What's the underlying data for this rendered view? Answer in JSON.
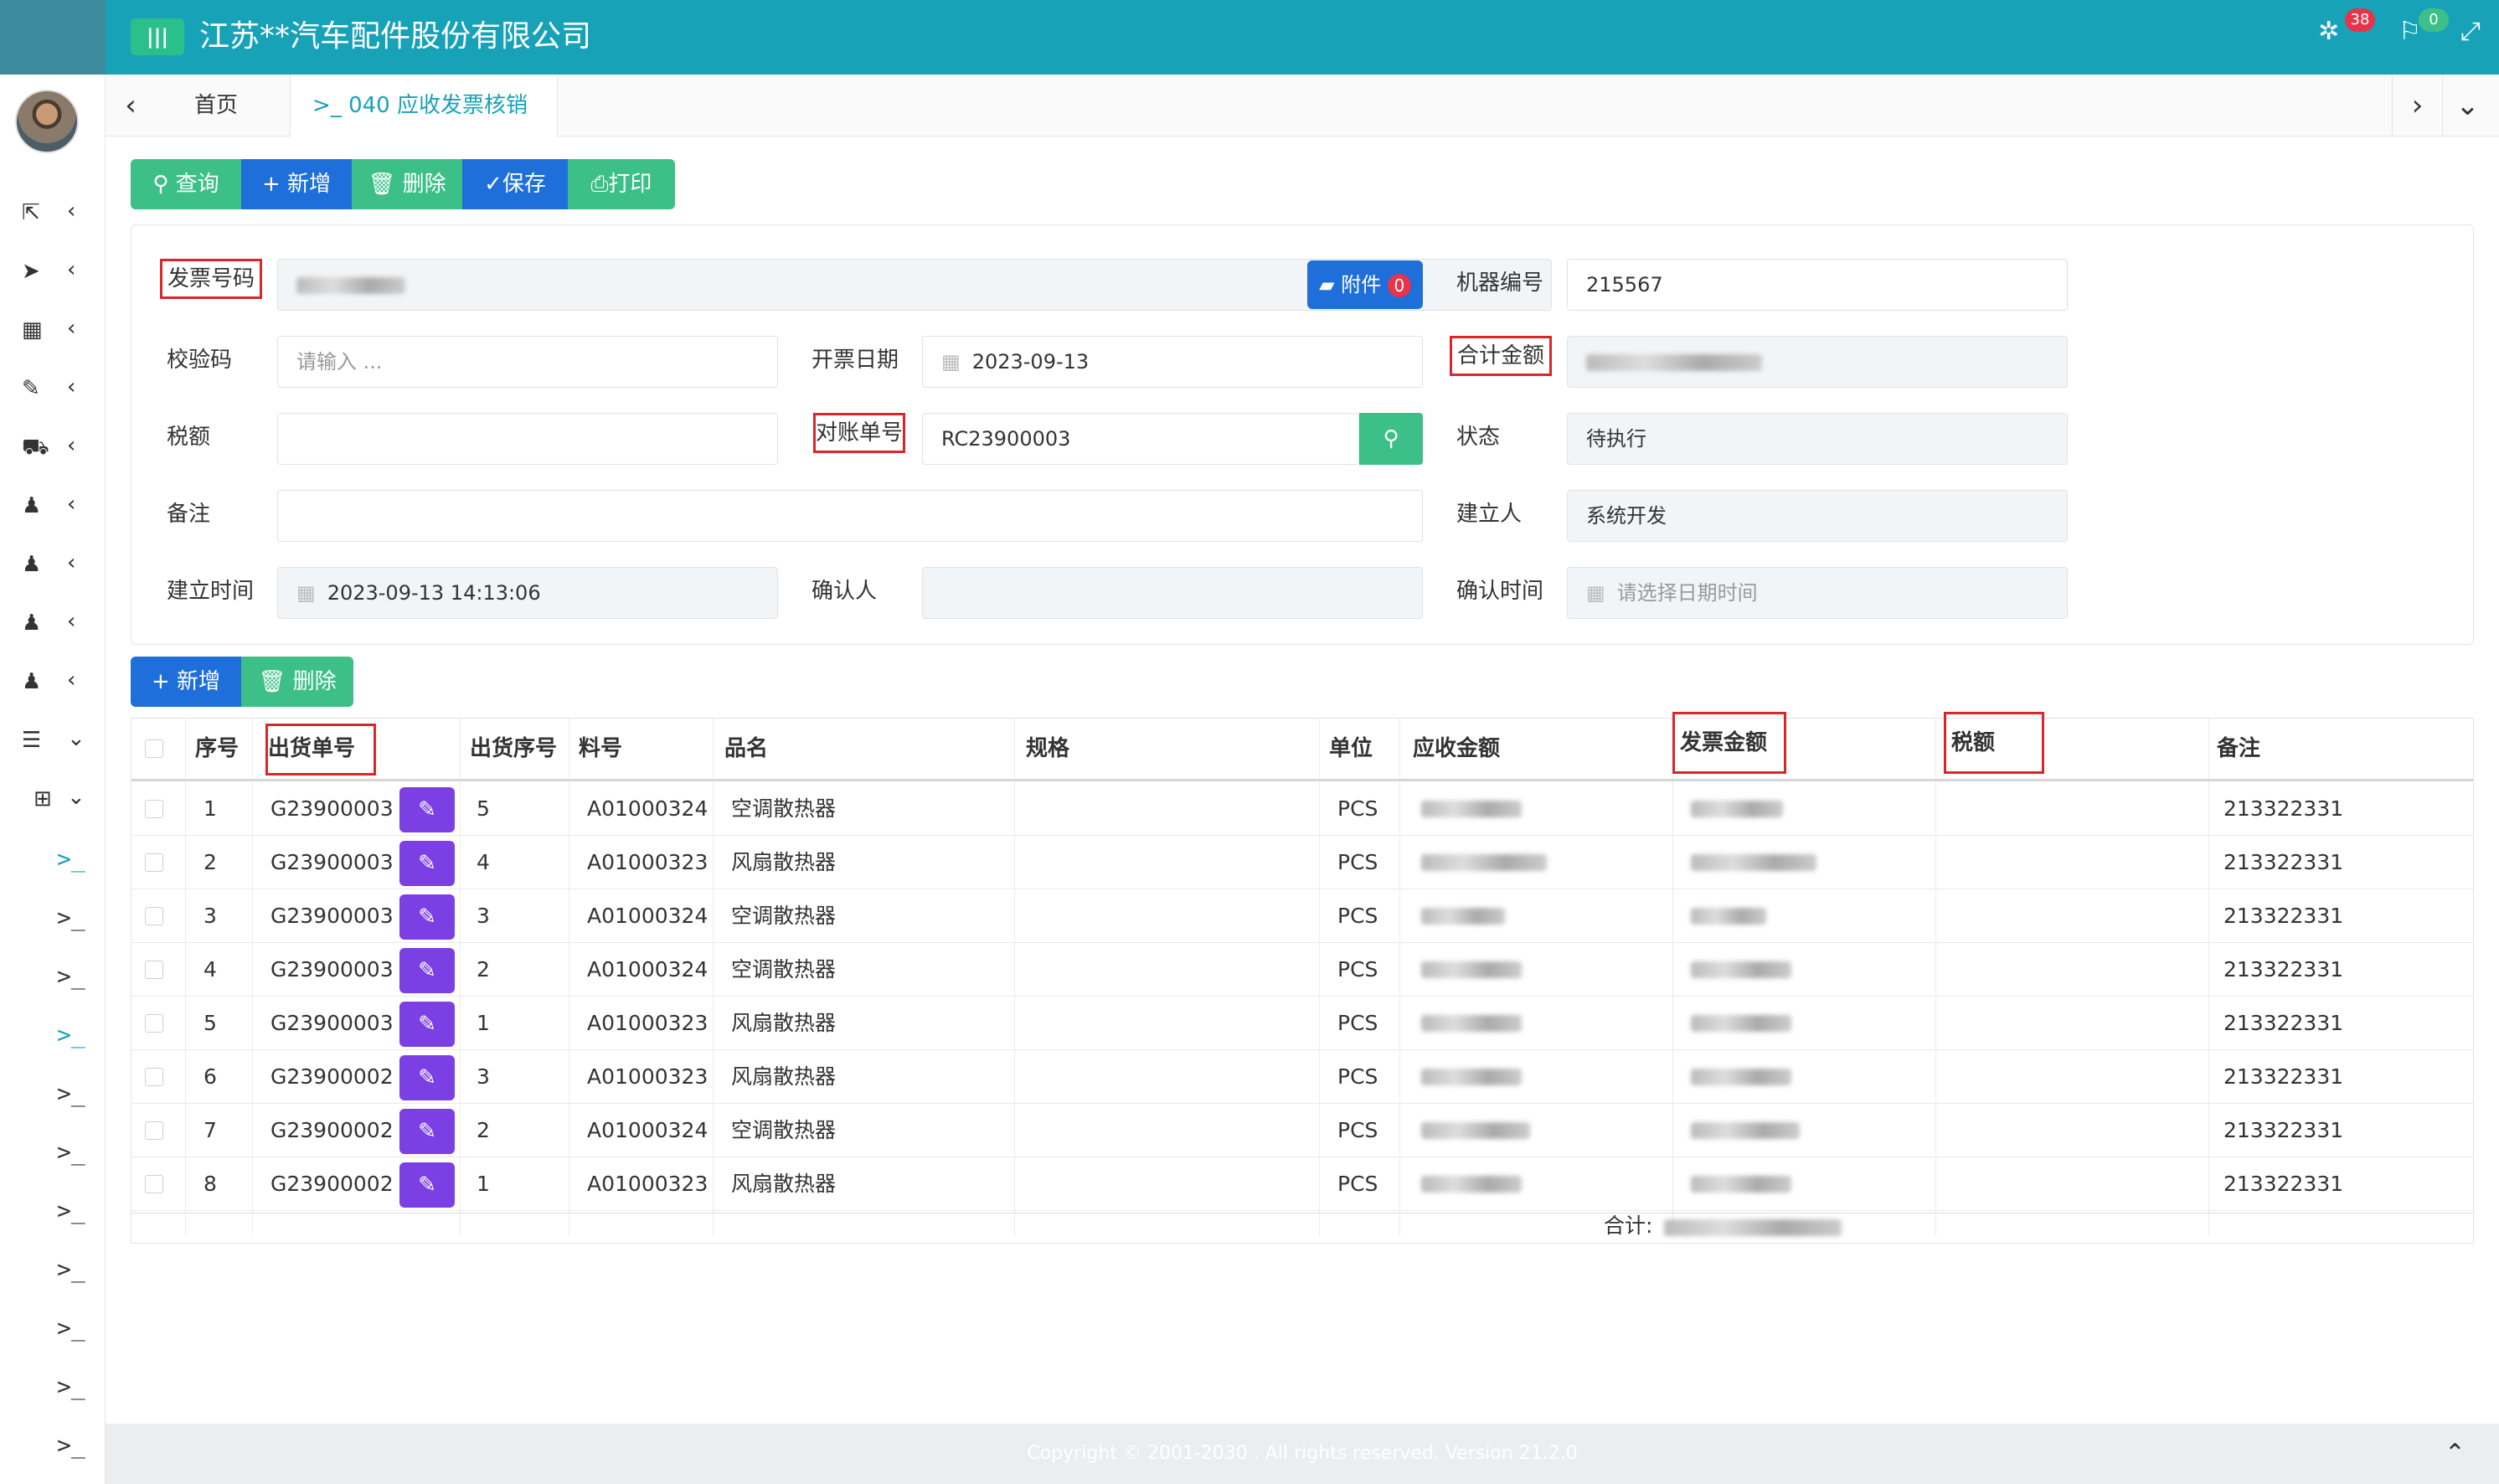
{
  "header": {
    "menu_icon": "menu-bars-icon",
    "company": "江苏**汽车配件股份有限公司",
    "notif_count": "38",
    "flag_count": "0",
    "colors": {
      "bar": "#17a2b8",
      "badge_red": "#e8334a",
      "badge_green": "#3cc087"
    }
  },
  "tabs": {
    "home": "首页",
    "active": "040 应收发票核销"
  },
  "toolbar": {
    "query": "查询",
    "add": "新增",
    "delete": "删除",
    "save": "保存",
    "print": "打印"
  },
  "form": {
    "invoice_no_label": "发票号码",
    "invoice_no_value": "",
    "attachment_label": "附件",
    "attachment_count": "0",
    "machine_no_label": "机器编号",
    "machine_no_value": "215567",
    "check_code_label": "校验码",
    "check_code_placeholder": "请输入 ...",
    "issue_date_label": "开票日期",
    "issue_date_value": "2023-09-13",
    "total_amount_label": "合计金额",
    "tax_label": "税额",
    "tax_value": "",
    "statement_no_label": "对账单号",
    "statement_no_value": "RC23900003",
    "status_label": "状态",
    "status_value": "待执行",
    "remark_label": "备注",
    "remark_value": "",
    "creator_label": "建立人",
    "creator_value": "系统开发",
    "created_time_label": "建立时间",
    "created_time_value": "2023-09-13 14:13:06",
    "confirmer_label": "确认人",
    "confirmer_value": "",
    "confirm_time_label": "确认时间",
    "confirm_time_placeholder": "请选择日期时间"
  },
  "detail_toolbar": {
    "add": "新增",
    "delete": "删除"
  },
  "table": {
    "columns": {
      "seq": "序号",
      "shipment_no": "出货单号",
      "shipment_seq": "出货序号",
      "part_no": "料号",
      "name": "品名",
      "spec": "规格",
      "unit": "单位",
      "receivable": "应收金额",
      "invoice_amount": "发票金额",
      "tax": "税额",
      "remark": "备注"
    },
    "rows": [
      {
        "seq": "1",
        "shipment_no": "G23900003",
        "shipment_seq": "5",
        "part_no": "A01000324",
        "name": "空调散热器",
        "spec": "",
        "unit": "PCS",
        "tax": "",
        "remark": "213322331"
      },
      {
        "seq": "2",
        "shipment_no": "G23900003",
        "shipment_seq": "4",
        "part_no": "A01000323",
        "name": "风扇散热器",
        "spec": "",
        "unit": "PCS",
        "tax": "",
        "remark": "213322331"
      },
      {
        "seq": "3",
        "shipment_no": "G23900003",
        "shipment_seq": "3",
        "part_no": "A01000324",
        "name": "空调散热器",
        "spec": "",
        "unit": "PCS",
        "tax": "",
        "remark": "213322331"
      },
      {
        "seq": "4",
        "shipment_no": "G23900003",
        "shipment_seq": "2",
        "part_no": "A01000324",
        "name": "空调散热器",
        "spec": "",
        "unit": "PCS",
        "tax": "",
        "remark": "213322331"
      },
      {
        "seq": "5",
        "shipment_no": "G23900003",
        "shipment_seq": "1",
        "part_no": "A01000323",
        "name": "风扇散热器",
        "spec": "",
        "unit": "PCS",
        "tax": "",
        "remark": "213322331"
      },
      {
        "seq": "6",
        "shipment_no": "G23900002",
        "shipment_seq": "3",
        "part_no": "A01000323",
        "name": "风扇散热器",
        "spec": "",
        "unit": "PCS",
        "tax": "",
        "remark": "213322331"
      },
      {
        "seq": "7",
        "shipment_no": "G23900002",
        "shipment_seq": "2",
        "part_no": "A01000324",
        "name": "空调散热器",
        "spec": "",
        "unit": "PCS",
        "tax": "",
        "remark": "213322331"
      },
      {
        "seq": "8",
        "shipment_no": "G23900002",
        "shipment_seq": "1",
        "part_no": "A01000323",
        "name": "风扇散热器",
        "spec": "",
        "unit": "PCS",
        "tax": "",
        "remark": "213322331"
      }
    ],
    "total_label": "合计:"
  },
  "footer": {
    "text": "Copyright © 2001-2030 . All rights reserved. Version 21.2.0"
  },
  "sidebar": {
    "icons": [
      "external-link-icon",
      "send-icon",
      "building-icon",
      "ruler-icon",
      "truck-icon",
      "bell-icon",
      "bell-icon",
      "bell-icon",
      "bell-icon",
      "server-icon",
      "add-box-icon"
    ]
  }
}
